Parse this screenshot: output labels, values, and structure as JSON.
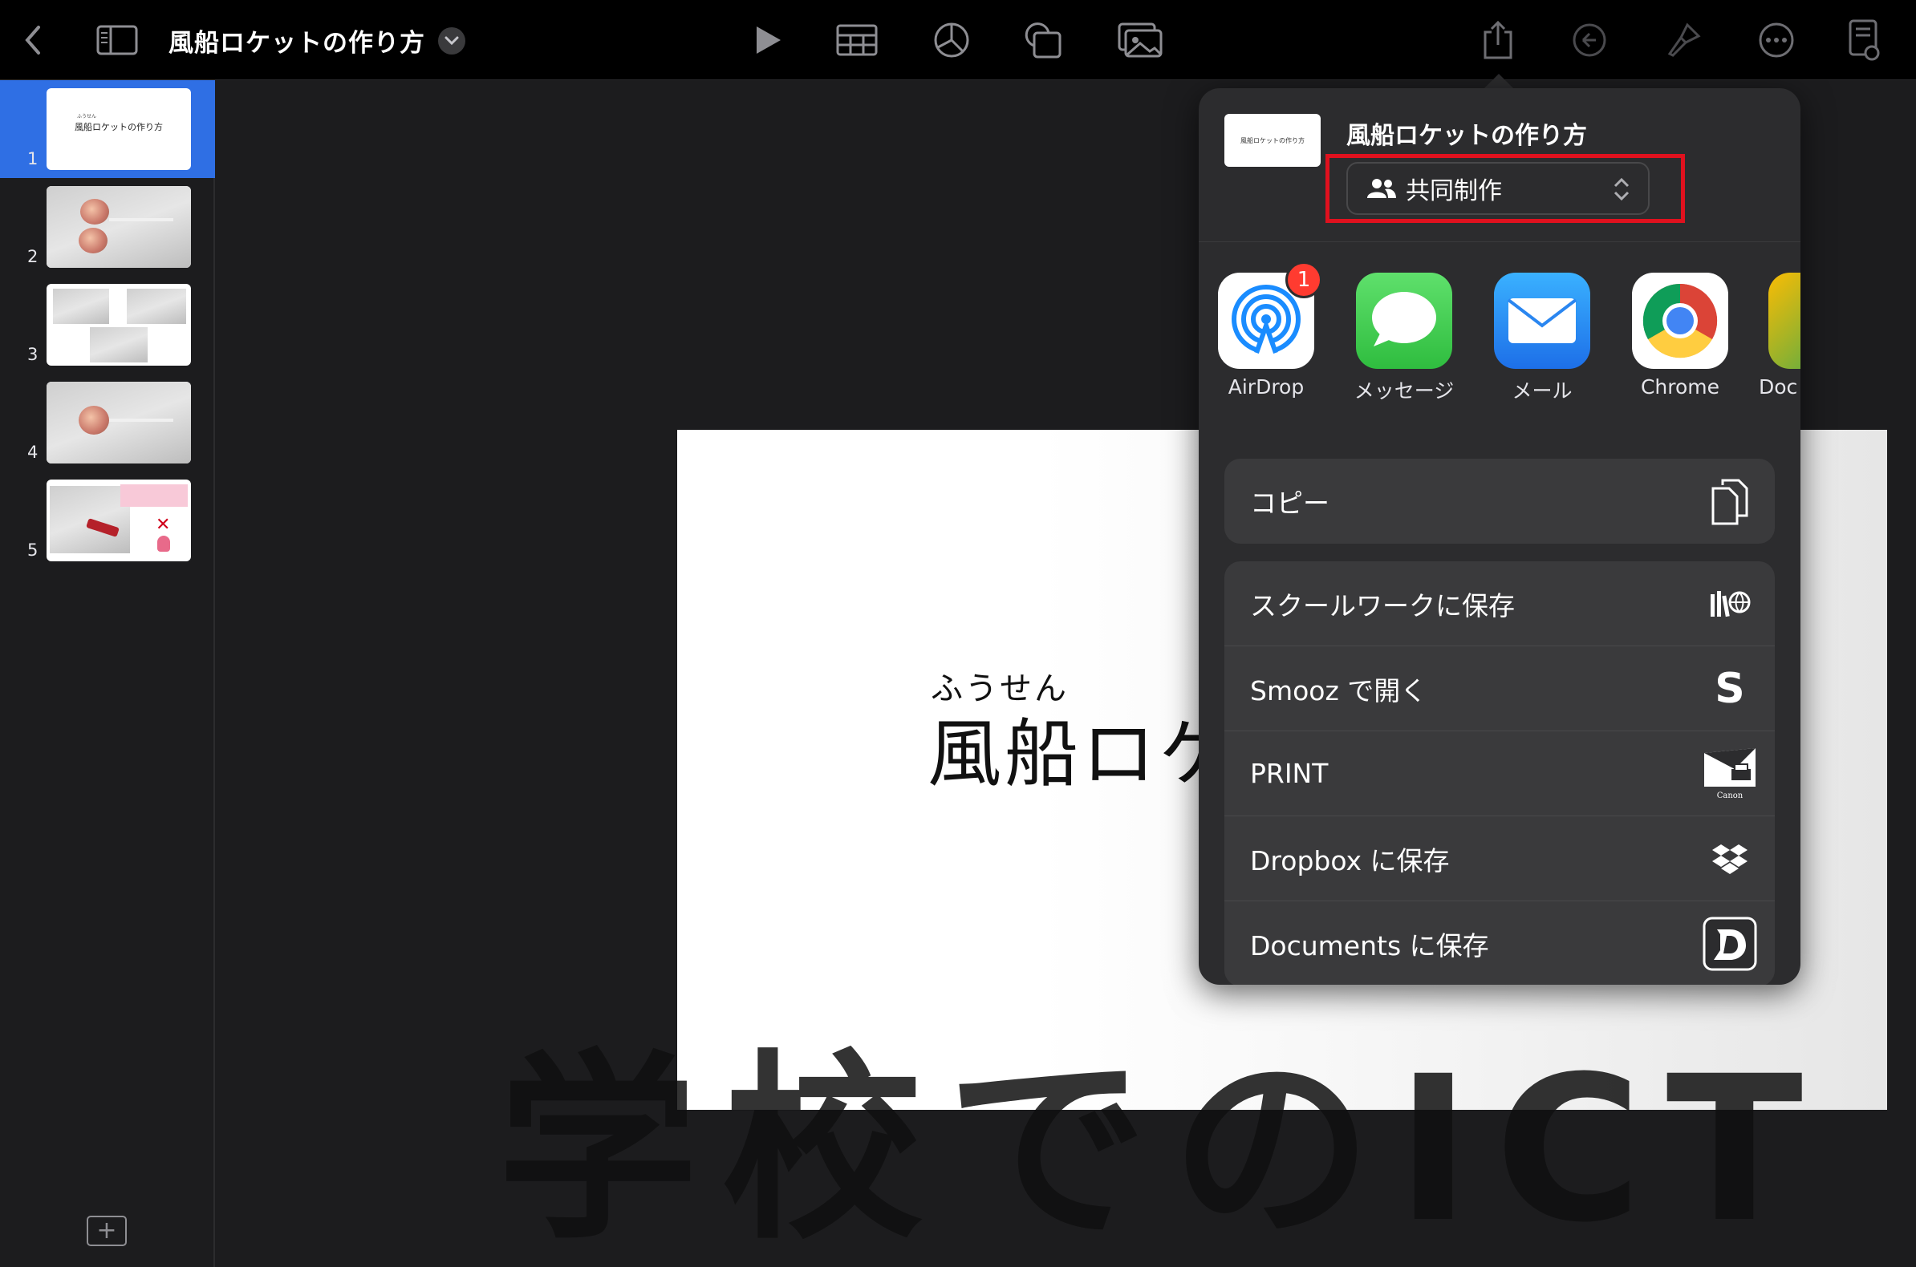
{
  "toolbar": {
    "back_icon": "chevron-left-icon",
    "sidebar_icon": "sidebar-icon",
    "doc_title": "風船ロケットの作り方",
    "title_menu_icon": "chevron-down-icon",
    "play_icon": "play-icon",
    "table_icon": "table-icon",
    "chart_icon": "chart-icon",
    "shape_icon": "shape-icon",
    "media_icon": "media-icon",
    "share_icon": "share-icon",
    "undo_icon": "undo-icon",
    "format_icon": "paintbrush-icon",
    "more_icon": "ellipsis-icon",
    "document_icon": "document-icon"
  },
  "navigator": {
    "slides": [
      {
        "num": "1",
        "title": "風船ロケットの作り方",
        "ruby": "ふうせん",
        "selected": true
      },
      {
        "num": "2"
      },
      {
        "num": "3"
      },
      {
        "num": "4"
      },
      {
        "num": "5"
      }
    ],
    "add_slide_icon": "plus-icon"
  },
  "slide": {
    "ruby": "ふうせん",
    "title": "風船ロケットの作り方"
  },
  "watermark": "学校でのICT",
  "share_sheet": {
    "doc_title": "風船ロケットの作り方",
    "collab_label": "共同制作",
    "apps": [
      {
        "label": "AirDrop",
        "badge": "1"
      },
      {
        "label": "メッセージ"
      },
      {
        "label": "メール"
      },
      {
        "label": "Chrome"
      },
      {
        "label": "Doc"
      }
    ],
    "copy_label": "コピー",
    "actions": [
      {
        "label": "スクールワークに保存",
        "icon": "schoolwork-icon"
      },
      {
        "label": "Smooz で開く",
        "icon": "smooz-icon"
      },
      {
        "label": "PRINT",
        "icon": "canon-print-icon"
      },
      {
        "label": "Dropbox に保存",
        "icon": "dropbox-icon"
      },
      {
        "label": "Documents に保存",
        "icon": "documents-icon"
      }
    ]
  },
  "colors": {
    "accent": "#2f6fe4",
    "highlight": "#e0111e",
    "sheet_bg": "#2c2c2e"
  }
}
